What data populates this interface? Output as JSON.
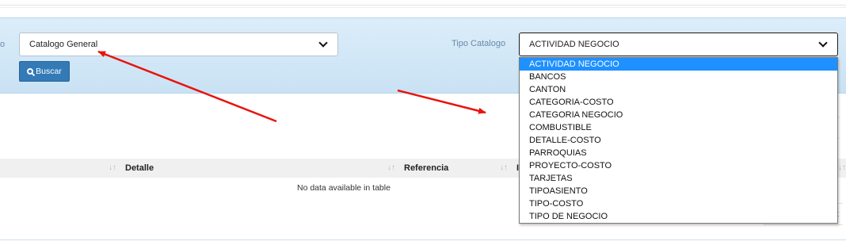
{
  "filters": {
    "general_select_value": "Catalogo General",
    "tipo_label": "Tipo Catalogo",
    "tipo_select_value": "ACTIVIDAD NEGOCIO",
    "buscar_label": "Buscar",
    "clipped_label": "o"
  },
  "dropdown": {
    "options": [
      "ACTIVIDAD NEGOCIO",
      "BANCOS",
      "CANTON",
      "CATEGORIA-COSTO",
      "CATEGORIA NEGOCIO",
      "COMBUSTIBLE",
      "DETALLE-COSTO",
      "PARROQUIAS",
      "PROYECTO-COSTO",
      "TARJETAS",
      "TIPOASIENTO",
      "TIPO-COSTO",
      "TIPO DE NEGOCIO"
    ],
    "selected_index": 0
  },
  "table": {
    "headers": [
      "Detalle",
      "Referencia",
      "I"
    ],
    "empty_message": "No data available in table",
    "sort_glyph": "↓↑"
  },
  "footer": {
    "clipped_text": "t"
  },
  "colors": {
    "panel": "#c9e2f4",
    "button": "#337ab7",
    "selected_option": "#1e90ff",
    "annotation_arrow": "#e8140f"
  },
  "icons": {
    "buscar": "search-icon",
    "select": "chevron-down-icon"
  }
}
